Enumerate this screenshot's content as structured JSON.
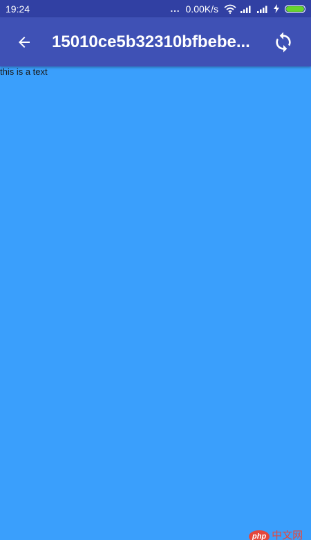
{
  "status_bar": {
    "time": "19:24",
    "dots": "...",
    "network_speed": "0.00K/s",
    "icons": [
      "wifi-icon",
      "signal-icon",
      "signal-icon",
      "charging-icon",
      "battery-icon"
    ],
    "battery_level": 1.0,
    "battery_color": "#68d42c"
  },
  "app_bar": {
    "title": "15010ce5b32310bfbebe...",
    "back_icon": "arrow-left-icon",
    "refresh_icon": "refresh-icon",
    "color": "#3f51b5"
  },
  "content": {
    "text": "this is a text",
    "background": "#3a9ffc"
  },
  "watermark": {
    "logo": "php",
    "text": "中文网"
  }
}
